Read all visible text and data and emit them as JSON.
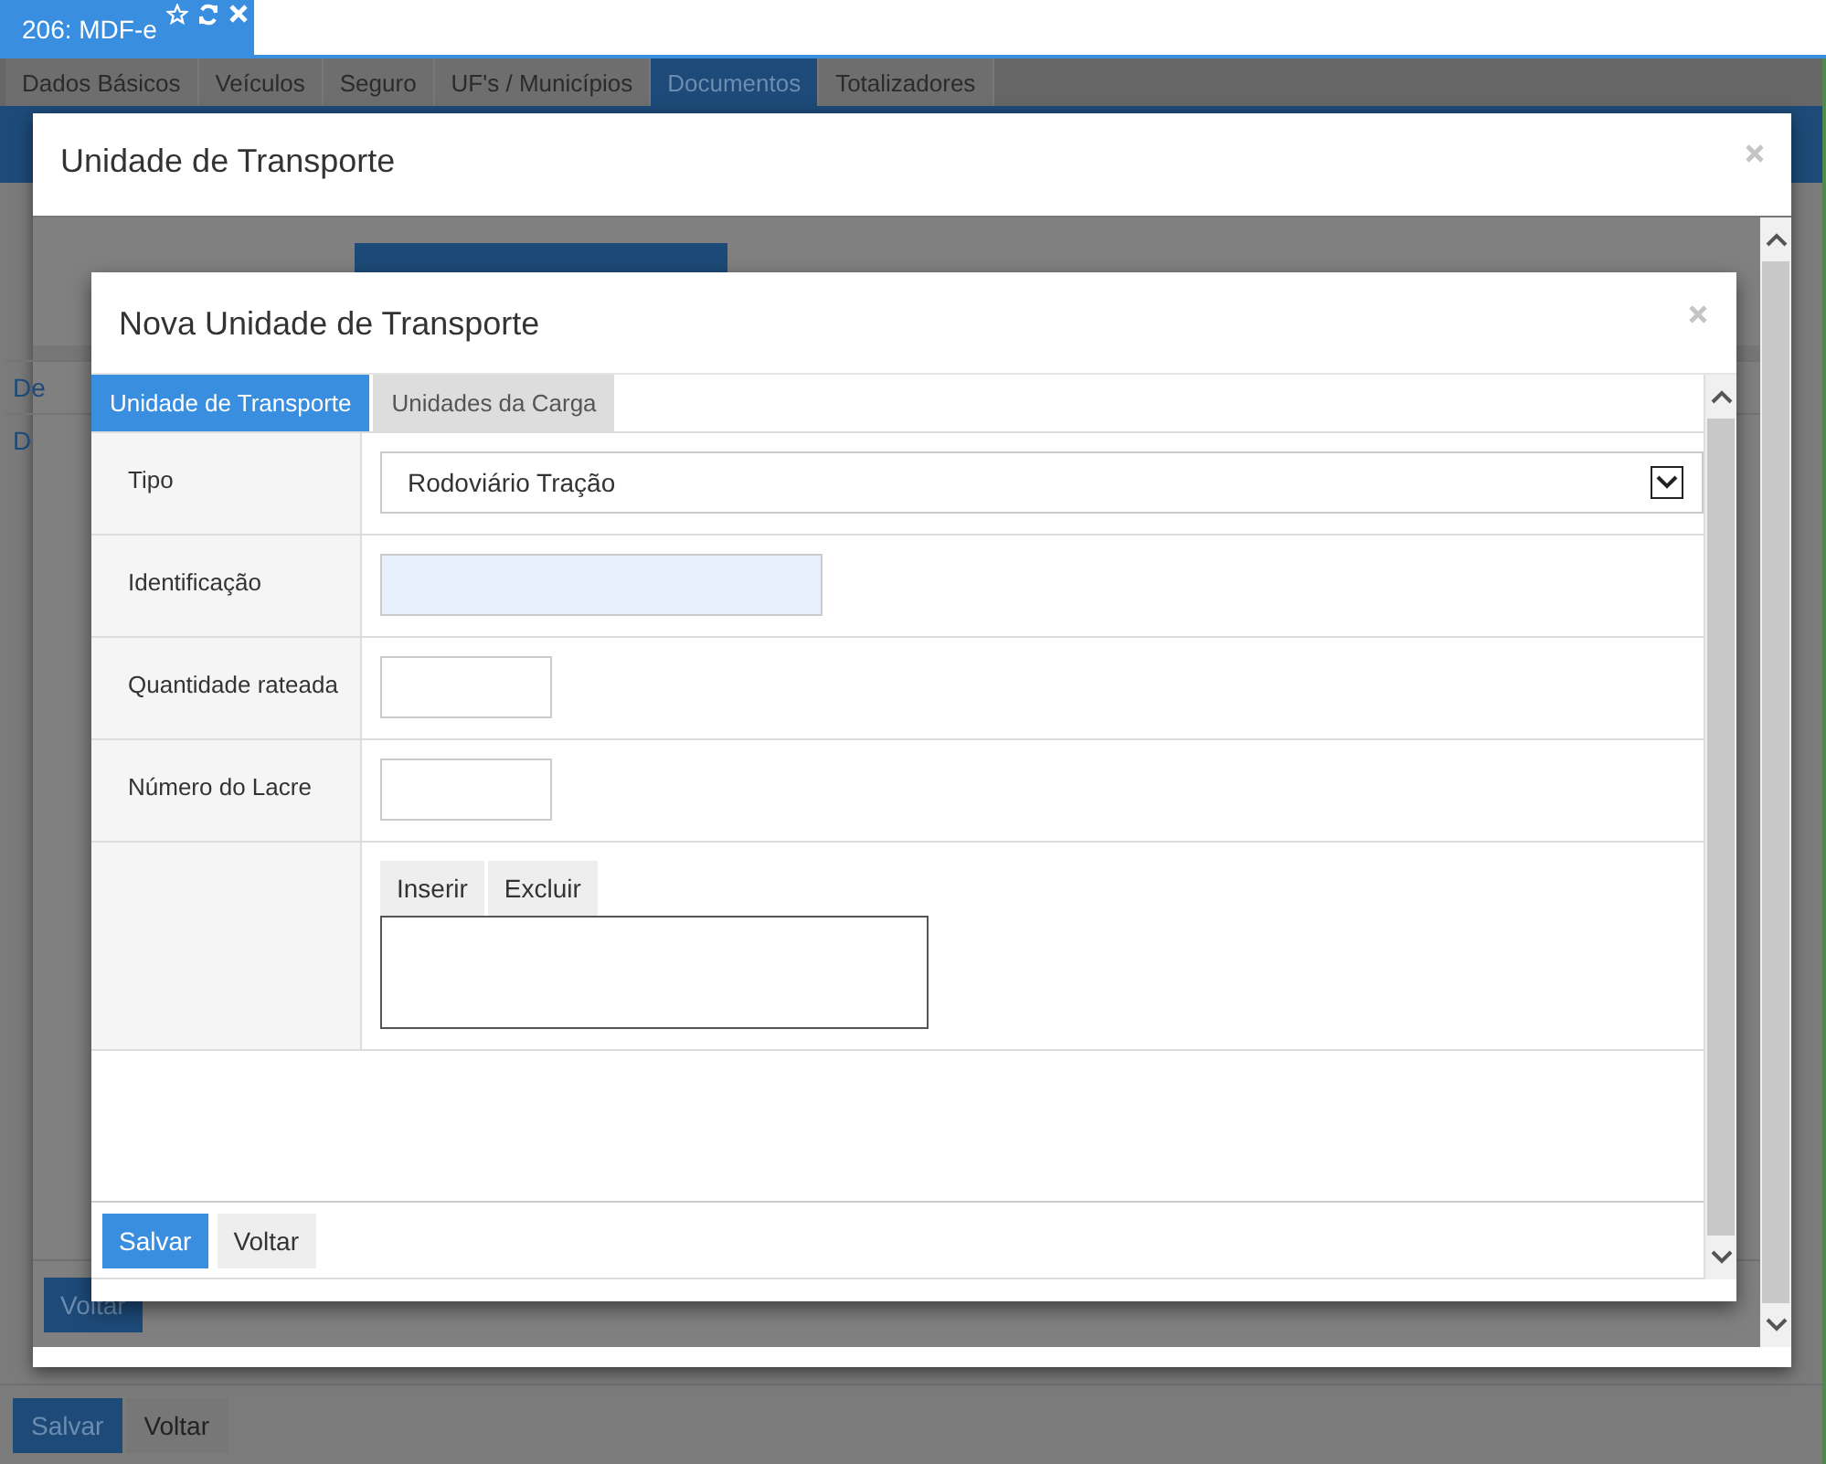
{
  "app_tab": {
    "title": "206: MDF-e"
  },
  "section_tabs": [
    {
      "label": "Dados Básicos",
      "selected": false
    },
    {
      "label": "Veículos",
      "selected": false
    },
    {
      "label": "Seguro",
      "selected": false
    },
    {
      "label": "UF's / Municípios",
      "selected": false
    },
    {
      "label": "Documentos",
      "selected": true
    },
    {
      "label": "Totalizadores",
      "selected": false
    }
  ],
  "dialog": {
    "title": "Unidade de Transporte",
    "rows": [
      "De",
      "D"
    ],
    "back_button": "Voltar"
  },
  "subdialog": {
    "title": "Nova Unidade de Transporte",
    "tabs": [
      {
        "label": "Unidade de Transporte",
        "selected": true
      },
      {
        "label": "Unidades da Carga",
        "selected": false
      }
    ],
    "fields": [
      {
        "kind": "select",
        "label": "Tipo",
        "value": "Rodoviário Tração"
      },
      {
        "kind": "wide-input",
        "label": "Identificação"
      },
      {
        "kind": "short-input",
        "label": "Quantidade rateada"
      },
      {
        "kind": "short-input",
        "label": "Número do Lacre"
      },
      {
        "kind": "list",
        "buttons": [
          "Inserir",
          "Excluir"
        ]
      }
    ],
    "buttons": [
      {
        "label": "Salvar",
        "primary": true
      },
      {
        "label": "Voltar",
        "primary": false
      }
    ]
  },
  "page_buttons": [
    {
      "label": "Salvar",
      "primary": true
    },
    {
      "label": "Voltar",
      "primary": false
    }
  ]
}
